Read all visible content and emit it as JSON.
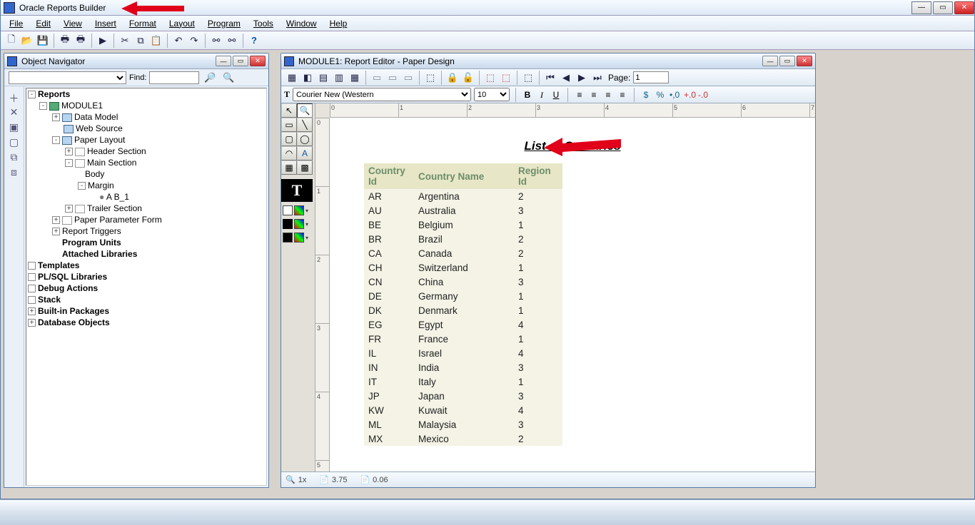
{
  "app_title": "Oracle Reports Builder",
  "menu": [
    "File",
    "Edit",
    "View",
    "Insert",
    "Format",
    "Layout",
    "Program",
    "Tools",
    "Window",
    "Help"
  ],
  "nav": {
    "title": "Object Navigator",
    "find_label": "Find:",
    "combo": "",
    "find_value": "",
    "root": "Reports",
    "module": "MODULE1",
    "items": {
      "data_model": "Data Model",
      "web_source": "Web Source",
      "paper_layout": "Paper Layout",
      "header_section": "Header Section",
      "main_section": "Main Section",
      "body": "Body",
      "margin": "Margin",
      "b1": "A  B_1",
      "trailer_section": "Trailer Section",
      "paper_param": "Paper Parameter Form",
      "report_triggers": "Report Triggers",
      "program_units": "Program Units",
      "attached_libraries": "Attached Libraries",
      "templates": "Templates",
      "plsql_libs": "PL/SQL Libraries",
      "debug_actions": "Debug Actions",
      "stack": "Stack",
      "builtin_packages": "Built-in Packages",
      "db_objects": "Database Objects"
    }
  },
  "editor": {
    "title": "MODULE1: Report Editor - Paper Design",
    "font_family": "Courier New (Western",
    "font_size": "10",
    "page_label": "Page:",
    "page_value": "1",
    "status": {
      "zoom": "1x",
      "x": "3.75",
      "y": "0.06"
    }
  },
  "report": {
    "title": "List of Countries",
    "cols": [
      "Country Id",
      "Country Name",
      "Region Id"
    ],
    "rows": [
      [
        "AR",
        "Argentina",
        "2"
      ],
      [
        "AU",
        "Australia",
        "3"
      ],
      [
        "BE",
        "Belgium",
        "1"
      ],
      [
        "BR",
        "Brazil",
        "2"
      ],
      [
        "CA",
        "Canada",
        "2"
      ],
      [
        "CH",
        "Switzerland",
        "1"
      ],
      [
        "CN",
        "China",
        "3"
      ],
      [
        "DE",
        "Germany",
        "1"
      ],
      [
        "DK",
        "Denmark",
        "1"
      ],
      [
        "EG",
        "Egypt",
        "4"
      ],
      [
        "FR",
        "France",
        "1"
      ],
      [
        "IL",
        "Israel",
        "4"
      ],
      [
        "IN",
        "India",
        "3"
      ],
      [
        "IT",
        "Italy",
        "1"
      ],
      [
        "JP",
        "Japan",
        "3"
      ],
      [
        "KW",
        "Kuwait",
        "4"
      ],
      [
        "ML",
        "Malaysia",
        "3"
      ],
      [
        "MX",
        "Mexico",
        "2"
      ]
    ]
  }
}
